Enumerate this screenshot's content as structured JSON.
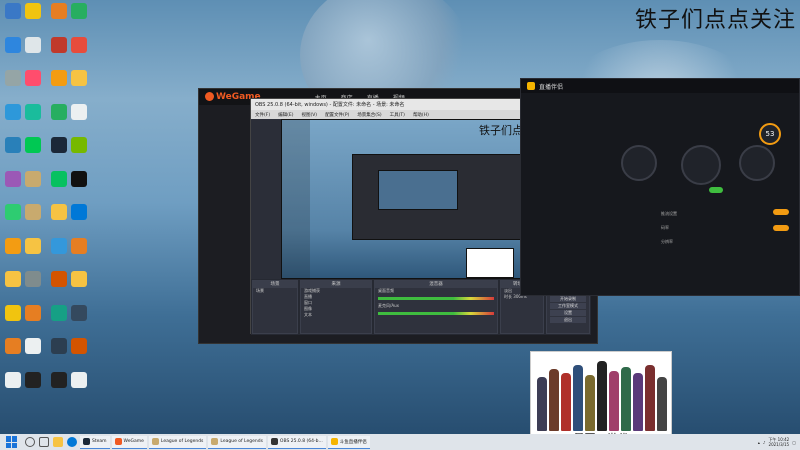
{
  "desktop": {
    "banner": "铁子们点点关注",
    "icons": [
      {
        "label": "",
        "icon": "computer-icon",
        "color": "#3a78c6"
      },
      {
        "label": "",
        "icon": "qq-music-icon",
        "color": "#f1c40f"
      },
      {
        "label": "",
        "icon": "ball-icon",
        "color": "#e67e22"
      },
      {
        "label": "",
        "icon": "app-icon",
        "color": "#27ae60"
      },
      {
        "label": "",
        "icon": "network-icon",
        "color": "#2e86de"
      },
      {
        "label": "",
        "icon": "cloud-icon",
        "color": "#dfe6e9"
      },
      {
        "label": "",
        "icon": "game-icon",
        "color": "#c0392b"
      },
      {
        "label": "",
        "icon": "music-icon",
        "color": "#e74c3c"
      },
      {
        "label": "",
        "icon": "settings-icon",
        "color": "#95a5a6"
      },
      {
        "label": "",
        "icon": "video-icon",
        "color": "#ff4d6d"
      },
      {
        "label": "",
        "icon": "rockstar-icon",
        "color": "#f39c12"
      },
      {
        "label": "",
        "icon": "folder-icon",
        "color": "#f6c343"
      },
      {
        "label": "",
        "icon": "mail-icon",
        "color": "#2d98da"
      },
      {
        "label": "",
        "icon": "player-icon",
        "color": "#1abc9c"
      },
      {
        "label": "",
        "icon": "chrome-icon",
        "color": "#27ae60"
      },
      {
        "label": "",
        "icon": "document-icon",
        "color": "#ecf0f1"
      },
      {
        "label": "",
        "icon": "shield-icon",
        "color": "#2980b9"
      },
      {
        "label": "",
        "icon": "iqiyi-icon",
        "color": "#00c853"
      },
      {
        "label": "",
        "icon": "steam-icon",
        "color": "#1b2838"
      },
      {
        "label": "",
        "icon": "nvidia-icon",
        "color": "#76b900"
      },
      {
        "label": "",
        "icon": "colorful-icon",
        "color": "#9b59b6"
      },
      {
        "label": "",
        "icon": "lol-icon",
        "color": "#c8aa6e"
      },
      {
        "label": "",
        "icon": "wechat-icon",
        "color": "#07c160"
      },
      {
        "label": "",
        "icon": "penguin-icon",
        "color": "#111111"
      },
      {
        "label": "",
        "icon": "green-app-icon",
        "color": "#2ecc71"
      },
      {
        "label": "",
        "icon": "lol-icon",
        "color": "#c8aa6e"
      },
      {
        "label": "",
        "icon": "folder-icon",
        "color": "#f6c343"
      },
      {
        "label": "",
        "icon": "edge-icon",
        "color": "#0078d7"
      },
      {
        "label": "",
        "icon": "character-icon",
        "color": "#f39c12"
      },
      {
        "label": "",
        "icon": "folder-icon",
        "color": "#f6c343"
      },
      {
        "label": "",
        "icon": "disk-icon",
        "color": "#3498db"
      },
      {
        "label": "",
        "icon": "character-icon",
        "color": "#e67e22"
      },
      {
        "label": "",
        "icon": "folder-icon",
        "color": "#f6c343"
      },
      {
        "label": "",
        "icon": "tool-icon",
        "color": "#7f8c8d"
      },
      {
        "label": "",
        "icon": "game-icon",
        "color": "#d35400"
      },
      {
        "label": "",
        "icon": "folder-icon",
        "color": "#f6c343"
      },
      {
        "label": "",
        "icon": "shield-icon",
        "color": "#f1c40f"
      },
      {
        "label": "",
        "icon": "ff-icon",
        "color": "#e67e22"
      },
      {
        "label": "",
        "icon": "app-icon",
        "color": "#16a085"
      },
      {
        "label": "",
        "icon": "monitor-icon",
        "color": "#34495e"
      },
      {
        "label": "",
        "icon": "box-icon",
        "color": "#e67e22"
      },
      {
        "label": "",
        "icon": "document-icon",
        "color": "#ecf0f1"
      },
      {
        "label": "",
        "icon": "app-icon",
        "color": "#2c3e50"
      },
      {
        "label": "",
        "icon": "box-icon",
        "color": "#d35400"
      },
      {
        "label": "",
        "icon": "document-icon",
        "color": "#ecf0f1"
      },
      {
        "label": "",
        "icon": "logitech-icon",
        "color": "#222222"
      },
      {
        "label": "",
        "icon": "obs-icon",
        "color": "#222222"
      },
      {
        "label": "",
        "icon": "document-icon",
        "color": "#ecf0f1"
      }
    ]
  },
  "wegame": {
    "brand": "WeGame",
    "nav": [
      "主页",
      "商店",
      "直播",
      "视频"
    ]
  },
  "obs": {
    "title": "OBS 25.0.8 (64-bit, windows) - 配置文件: 未命名 - 场景: 未命名",
    "menu": [
      "文件(F)",
      "编辑(E)",
      "视图(V)",
      "配置文件(P)",
      "场景集合(S)",
      "工具(T)",
      "帮助(H)"
    ],
    "window_controls": [
      "–",
      "□",
      "✕"
    ],
    "preview_banner": "铁子们点点关注",
    "docks": [
      {
        "title": "场景",
        "rows": [
          "场景"
        ]
      },
      {
        "title": "来源",
        "rows": [
          "游戏捕获",
          "直播",
          "窗口",
          "图像",
          "文本"
        ]
      },
      {
        "title": "混音器",
        "rows": [
          "桌面音频",
          "麦克风/Aux"
        ]
      },
      {
        "title": "转场特效",
        "rows": [
          "淡出",
          "时长 300ms"
        ]
      },
      {
        "title": "控件",
        "buttons": [
          "开始推流",
          "开始录制",
          "工作室模式",
          "设置",
          "退出"
        ]
      }
    ]
  },
  "live": {
    "brand": "直播伴侣",
    "speed": "53",
    "labels": [
      "推流设置",
      "码率",
      "分辨率"
    ]
  },
  "poster": {
    "caption": "最悪の世代"
  },
  "taskbar": {
    "tasks": [
      {
        "label": "Steam",
        "color": "#1b2838"
      },
      {
        "label": "WeGame",
        "color": "#f05a22"
      },
      {
        "label": "League of Legends",
        "color": "#c8aa6e"
      },
      {
        "label": "League of Legends",
        "color": "#c8aa6e"
      },
      {
        "label": "OBS 25.0.8 (64-b...",
        "color": "#333333"
      },
      {
        "label": "斗鱼直播伴侣",
        "color": "#f5b400"
      }
    ],
    "time": "下午 10:42",
    "date": "2021/3/15"
  }
}
